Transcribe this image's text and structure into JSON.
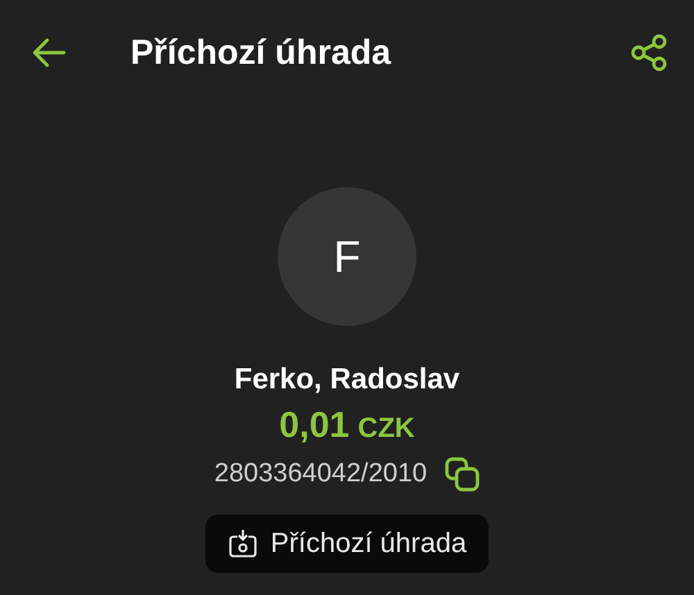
{
  "header": {
    "title": "Příchozí úhrada"
  },
  "counterparty": {
    "initial": "F",
    "name": "Ferko, Radoslav"
  },
  "amount": {
    "value": "0,01",
    "currency": "CZK"
  },
  "account": {
    "number": "2803364042/2010"
  },
  "type_chip": {
    "label": "Příchozí úhrada"
  }
}
